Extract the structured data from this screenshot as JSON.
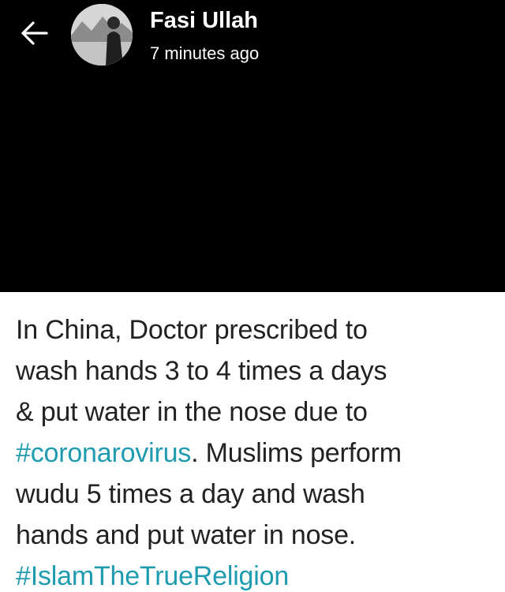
{
  "header": {
    "back_icon": "arrow-left-icon",
    "author_name": "Fasi Ullah",
    "timestamp": "7 minutes ago"
  },
  "post": {
    "line1": "In China, Doctor prescribed to",
    "line2": "wash hands 3 to 4 times a days",
    "line3": "& put water in the nose due to",
    "hashtag1": "#coronarovirus",
    "line4_rest": ". Muslims perform",
    "line5": "wudu 5 times a day and wash",
    "line6": "hands and put water in nose.",
    "hashtag2": "#IslamTheTrueReligion"
  },
  "colors": {
    "story_background": "#000000",
    "post_background": "#ffffff",
    "hashtag": "#1f9bb0",
    "text": "#222222"
  }
}
